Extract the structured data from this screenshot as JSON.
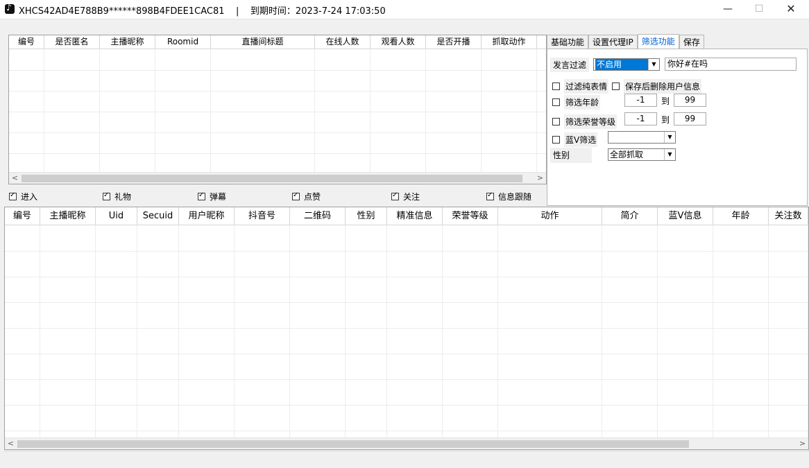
{
  "window": {
    "title": "XHCS42AD4E788B9******898B4FDEE1CAC81    |    到期时间：2023-7-24 17:03:50",
    "min": "—",
    "max": "☐",
    "close": "✕"
  },
  "top_grid": {
    "columns": [
      "编号",
      "是否匿名",
      "主播昵称",
      "Roomid",
      "直播间标题",
      "在线人数",
      "观看人数",
      "是否开播",
      "抓取动作"
    ],
    "scroll_left": "<",
    "scroll_right": ">"
  },
  "event_checks": [
    {
      "label": "进入",
      "checked": true
    },
    {
      "label": "礼物",
      "checked": true
    },
    {
      "label": "弹幕",
      "checked": true
    },
    {
      "label": "点赞",
      "checked": true
    },
    {
      "label": "关注",
      "checked": true
    },
    {
      "label": "信息跟随",
      "checked": true
    }
  ],
  "tabs": [
    {
      "label": "基础功能",
      "active": false
    },
    {
      "label": "设置代理IP",
      "active": false
    },
    {
      "label": "筛选功能",
      "active": true
    },
    {
      "label": "保存",
      "active": false
    }
  ],
  "filter": {
    "speech_label": "发言过滤",
    "speech_select": "不启用",
    "speech_text": "你好#在吗",
    "pure_emoji": "过滤纯表情",
    "delete_after_save": "保存后删除用户信息",
    "age_label": "筛选年龄",
    "age_min": "-1",
    "age_to": "到",
    "age_max": "99",
    "honor_label": "筛选荣誉等级",
    "honor_min": "-1",
    "honor_to": "到",
    "honor_max": "99",
    "bluev_label": "蓝V筛选",
    "bluev_select": "",
    "gender_label": "性别",
    "gender_select": "全部抓取"
  },
  "bottom_grid": {
    "columns": [
      "编号",
      "主播昵称",
      "Uid",
      "Secuid",
      "用户昵称",
      "抖音号",
      "二维码",
      "性别",
      "精准信息",
      "荣誉等级",
      "动作",
      "简介",
      "蓝V信息",
      "年龄",
      "关注数"
    ],
    "scroll_left": "<",
    "scroll_right": ">"
  }
}
